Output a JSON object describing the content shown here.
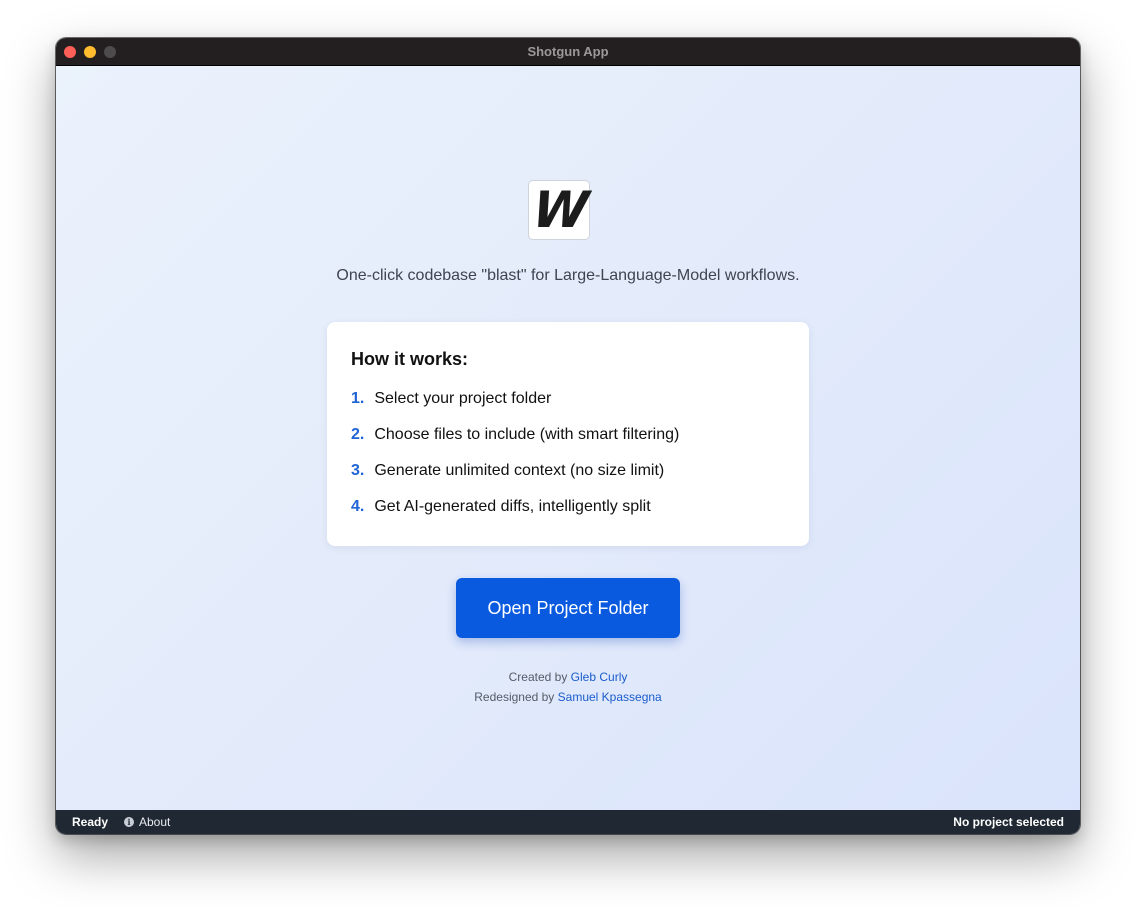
{
  "window": {
    "title": "Shotgun App"
  },
  "logo": {
    "letter": "W"
  },
  "tagline": "One-click codebase \"blast\" for Large-Language-Model workflows.",
  "how_it_works": {
    "title": "How it works:",
    "steps": [
      {
        "num": "1.",
        "text": "Select your project folder"
      },
      {
        "num": "2.",
        "text": "Choose files to include (with smart filtering)"
      },
      {
        "num": "3.",
        "text": "Generate unlimited context (no size limit)"
      },
      {
        "num": "4.",
        "text": "Get AI-generated diffs, intelligently split"
      }
    ]
  },
  "open_button": {
    "label": "Open Project Folder"
  },
  "credits": {
    "created_prefix": "Created by",
    "created_name": "Gleb Curly",
    "redesigned_prefix": "Redesigned by",
    "redesigned_name": "Samuel Kpassegna"
  },
  "statusbar": {
    "ready": "Ready",
    "about": "About",
    "project": "No project selected"
  },
  "colors": {
    "accent": "#0a5ae0",
    "step_number": "#1f63d6",
    "statusbar_bg": "#1f2833",
    "titlebar_bg": "#231f20"
  }
}
